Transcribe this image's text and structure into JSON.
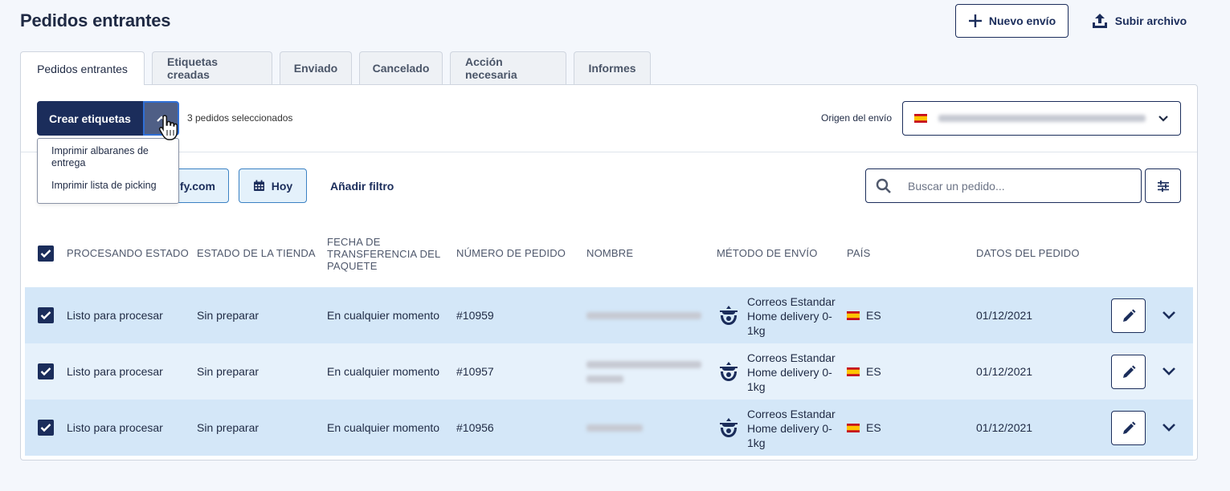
{
  "header": {
    "title": "Pedidos entrantes",
    "new_shipment_label": "Nuevo envío",
    "upload_label": "Subir archivo"
  },
  "tabs": [
    {
      "label": "Pedidos entrantes",
      "active": true
    },
    {
      "label": "Etiquetas creadas",
      "active": false
    },
    {
      "label": "Enviado",
      "active": false
    },
    {
      "label": "Cancelado",
      "active": false
    },
    {
      "label": "Acción necesaria",
      "active": false
    },
    {
      "label": "Informes",
      "active": false
    }
  ],
  "toolbar": {
    "create_labels": "Crear etiquetas",
    "selected_count_text": "3 pedidos seleccionados",
    "origin_label": "Origen del envío",
    "origin_value_redacted": true
  },
  "dropdown": {
    "items": [
      "Imprimir albaranes de entrega",
      "Imprimir lista de picking"
    ]
  },
  "filters": {
    "store_chip": "ify.com",
    "date_chip": "Hoy",
    "add_filter": "Añadir filtro",
    "search_placeholder": "Buscar un pedido..."
  },
  "table": {
    "headers": [
      "PROCESANDO ESTADO",
      "ESTADO DE LA TIENDA",
      "FECHA DE TRANSFERENCIA DEL PAQUETE",
      "NÚMERO DE PEDIDO",
      "NOMBRE",
      "MÉTODO DE ENVÍO",
      "PAÍS",
      "DATOS DEL PEDIDO"
    ],
    "rows": [
      {
        "status": "Listo para procesar",
        "store_status": "Sin preparar",
        "transfer": "En cualquier momento",
        "order": "#10959",
        "name_redacted": true,
        "method": "Correos Estandar Home delivery 0-1kg",
        "country": "ES",
        "date": "01/12/2021",
        "checked": true
      },
      {
        "status": "Listo para procesar",
        "store_status": "Sin preparar",
        "transfer": "En cualquier momento",
        "order": "#10957",
        "name_redacted": true,
        "method": "Correos Estandar Home delivery 0-1kg",
        "country": "ES",
        "date": "01/12/2021",
        "checked": true
      },
      {
        "status": "Listo para procesar",
        "store_status": "Sin preparar",
        "transfer": "En cualquier momento",
        "order": "#10956",
        "name_redacted": true,
        "method": "Correos Estandar Home delivery 0-1kg",
        "country": "ES",
        "date": "01/12/2021",
        "checked": true
      }
    ]
  },
  "colors": {
    "primary": "#1b2d5b",
    "row_selected": "#d4e7f8",
    "row_alt": "#e6f1fb",
    "page_bg": "#f4f7fc"
  },
  "icons": [
    "plus-icon",
    "upload-icon",
    "chevron-up-icon",
    "spain-flag-icon",
    "chevron-down-icon",
    "calendar-icon",
    "search-icon",
    "sliders-icon",
    "checkbox-checked-icon",
    "correos-logo-icon",
    "pencil-icon",
    "hand-cursor-icon"
  ]
}
